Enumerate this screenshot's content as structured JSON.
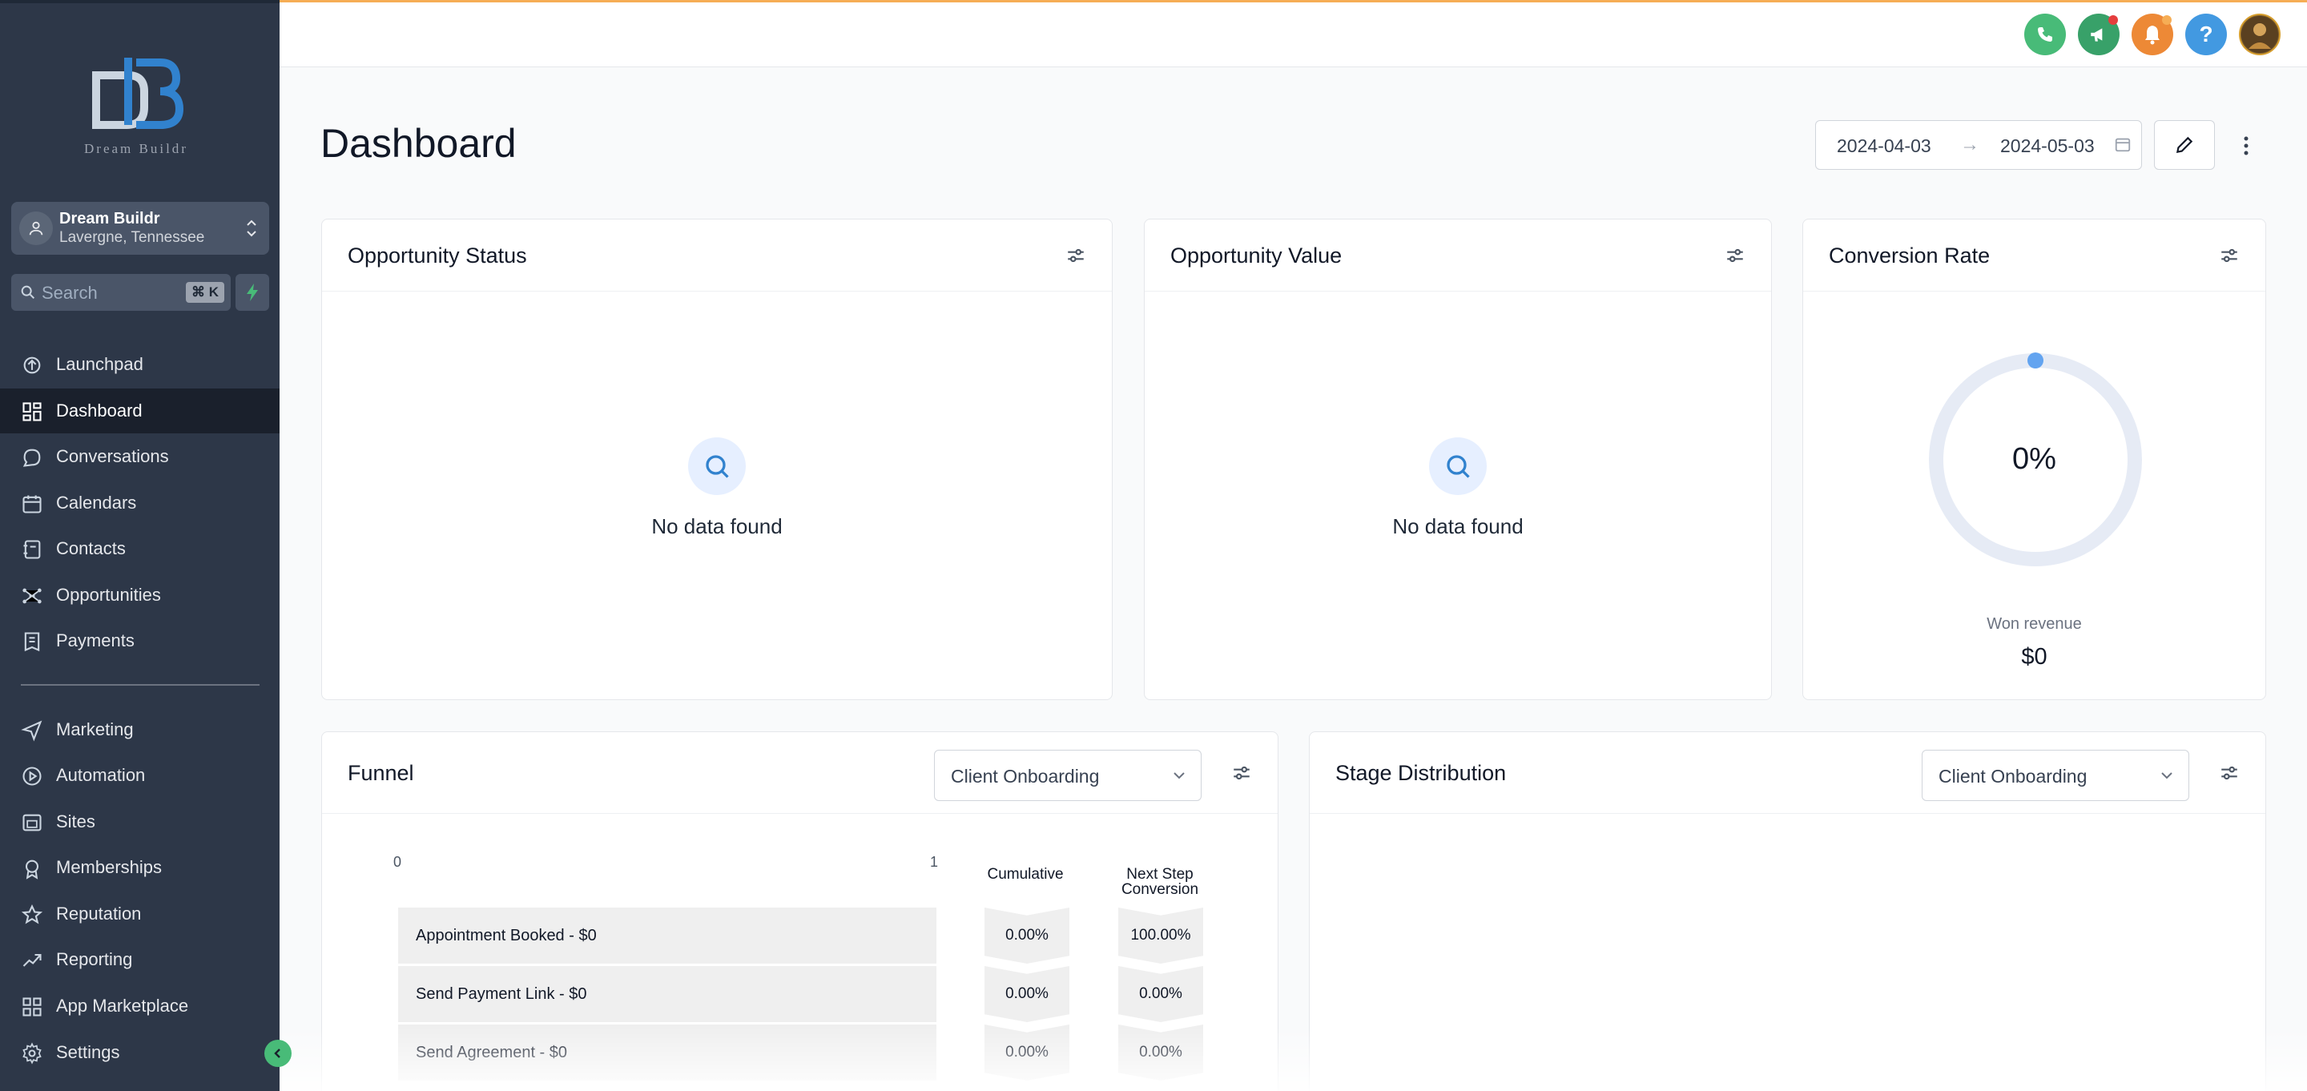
{
  "brand": {
    "logo_text": "Dream Buildr"
  },
  "account": {
    "name": "Dream Buildr",
    "location": "Lavergne, Tennessee"
  },
  "search": {
    "placeholder": "Search",
    "shortcut": "⌘ K"
  },
  "sidebar": {
    "items": [
      {
        "label": "Launchpad",
        "icon": "launchpad-icon"
      },
      {
        "label": "Dashboard",
        "icon": "dashboard-grid-icon",
        "active": true
      },
      {
        "label": "Conversations",
        "icon": "chat-bubble-icon"
      },
      {
        "label": "Calendars",
        "icon": "calendar-icon"
      },
      {
        "label": "Contacts",
        "icon": "contacts-book-icon"
      },
      {
        "label": "Opportunities",
        "icon": "network-icon"
      },
      {
        "label": "Payments",
        "icon": "receipt-icon"
      },
      {
        "label": "Marketing",
        "icon": "send-icon"
      },
      {
        "label": "Automation",
        "icon": "play-circle-icon"
      },
      {
        "label": "Sites",
        "icon": "browser-icon"
      },
      {
        "label": "Memberships",
        "icon": "badge-icon"
      },
      {
        "label": "Reputation",
        "icon": "star-icon"
      },
      {
        "label": "Reporting",
        "icon": "trend-up-icon"
      },
      {
        "label": "App Marketplace",
        "icon": "apps-grid-icon"
      },
      {
        "label": "Settings",
        "icon": "gear-icon"
      }
    ]
  },
  "topbar": {
    "buttons": [
      {
        "name": "phone-button",
        "color": "#48bb78"
      },
      {
        "name": "announcements-button",
        "color": "#38a169"
      },
      {
        "name": "notifications-button",
        "color": "#ed8936"
      },
      {
        "name": "help-button",
        "color": "#4299e1",
        "glyph": "?"
      },
      {
        "name": "user-avatar"
      }
    ]
  },
  "page": {
    "title": "Dashboard",
    "date_start": "2024-04-03",
    "date_end": "2024-05-03"
  },
  "cards": {
    "opportunity_status": {
      "title": "Opportunity Status",
      "empty_text": "No data found"
    },
    "opportunity_value": {
      "title": "Opportunity Value",
      "empty_text": "No data found"
    },
    "conversion_rate": {
      "title": "Conversion Rate",
      "value": "0%",
      "revenue_label": "Won revenue",
      "revenue_value": "$0",
      "rate": 0
    },
    "funnel": {
      "title": "Funnel",
      "pipeline": "Client Onboarding",
      "axis_min": "0",
      "axis_max": "1",
      "col_cumulative": "Cumulative",
      "col_next": "Next Step Conversion",
      "stages": [
        {
          "label": "Appointment Booked - $0",
          "cumulative": "0.00%",
          "next": "100.00%"
        },
        {
          "label": "Send Payment Link - $0",
          "cumulative": "0.00%",
          "next": "0.00%"
        },
        {
          "label": "Send Agreement - $0",
          "cumulative": "0.00%",
          "next": "0.00%"
        }
      ]
    },
    "stage_distribution": {
      "title": "Stage Distribution",
      "pipeline": "Client Onboarding"
    }
  }
}
